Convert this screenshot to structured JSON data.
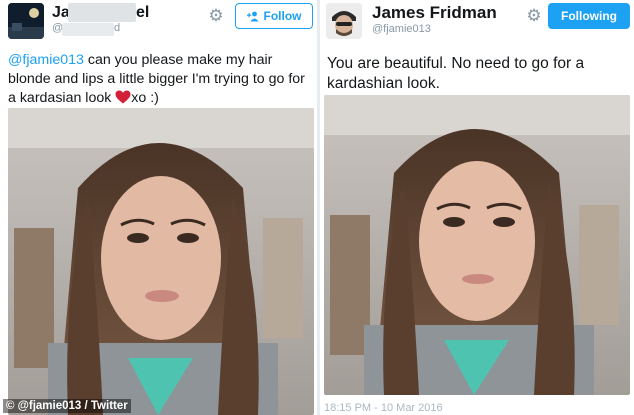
{
  "left_tweet": {
    "display_name_start": "Ja",
    "display_name_end": "el",
    "handle_start": "@j",
    "handle_end": "d",
    "follow_label": "Follow",
    "follow_icon": "person-plus-icon",
    "text_mention": "@fjamie013",
    "text_body": " can you please make my hair blonde and lips a little bigger I'm trying to go for a kardasian look ",
    "text_after_heart": "xo :)",
    "heart_icon": "red-heart-emoji",
    "photo_credit": "© @fjamie013 / Twitter"
  },
  "right_tweet": {
    "display_name": "James Fridman",
    "handle": "@fjamie013",
    "follow_label": "Following",
    "text": "You are beautiful. No need to go for a kardashian look.",
    "timestamp": "18:15 PM - 10 Mar 2016"
  },
  "colors": {
    "accent": "#1da1f2",
    "text": "#14171a",
    "muted": "#8899a6",
    "heart": "#d4213a"
  }
}
